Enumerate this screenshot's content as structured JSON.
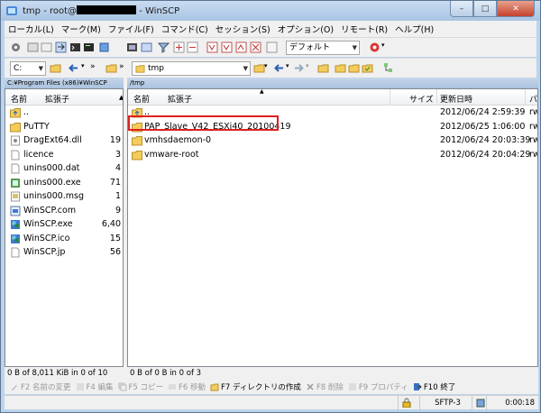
{
  "title": {
    "prefix": "tmp - root@",
    "suffix": " - WinSCP"
  },
  "window_buttons": {
    "minimize": "–",
    "maximize": "□",
    "close": "✕"
  },
  "menu": [
    "ローカル(L)",
    "マーク(M)",
    "ファイル(F)",
    "コマンド(C)",
    "セッション(S)",
    "オプション(O)",
    "リモート(R)",
    "ヘルプ(H)"
  ],
  "toolbar": {
    "transfer_setting": "デフォルト"
  },
  "local": {
    "drive": "C:",
    "path": "C:¥Program Files (x86)¥WinSCP",
    "columns": {
      "name": "名前",
      "ext": "拡張子"
    },
    "files": [
      {
        "name": "..",
        "size": "",
        "icon": "parent-folder-icon"
      },
      {
        "name": "PuTTY",
        "size": "",
        "icon": "folder-icon"
      },
      {
        "name": "DragExt64.dll",
        "size": "19",
        "icon": "dll-file-icon"
      },
      {
        "name": "licence",
        "size": "3",
        "icon": "text-file-icon"
      },
      {
        "name": "unins000.dat",
        "size": "4",
        "icon": "text-file-icon"
      },
      {
        "name": "unins000.exe",
        "size": "71",
        "icon": "exe-file-icon"
      },
      {
        "name": "unins000.msg",
        "size": "1",
        "icon": "msg-file-icon"
      },
      {
        "name": "WinSCP.com",
        "size": "9",
        "icon": "com-file-icon"
      },
      {
        "name": "WinSCP.exe",
        "size": "6,40",
        "icon": "winscp-exe-icon"
      },
      {
        "name": "WinSCP.ico",
        "size": "15",
        "icon": "winscp-ico-icon"
      },
      {
        "name": "WinSCP.jp",
        "size": "56",
        "icon": "text-file-icon"
      }
    ],
    "status": "0 B of 8,011 KiB in 0 of 10"
  },
  "remote": {
    "folder": "tmp",
    "path": "/tmp",
    "columns": {
      "name": "名前",
      "ext": "拡張子",
      "size": "サイズ",
      "modified": "更新日時",
      "rights": "パ"
    },
    "files": [
      {
        "name": "..",
        "modified": "2012/06/24 2:59:39",
        "rights": "rw",
        "icon": "parent-folder-icon"
      },
      {
        "name": "PAP_Slave_V42_ESXi40_20100419",
        "modified": "2012/06/25 1:06:00",
        "rights": "rw",
        "icon": "folder-icon"
      },
      {
        "name": "vmhsdaemon-0",
        "modified": "2012/06/24 20:03:39",
        "rights": "rw",
        "icon": "folder-icon"
      },
      {
        "name": "vmware-root",
        "modified": "2012/06/24 20:04:29",
        "rights": "rw",
        "icon": "folder-icon"
      }
    ],
    "status": "0 B of 0 B in 0 of 3"
  },
  "fkeys": [
    {
      "label": "F2 名前の変更",
      "enabled": false
    },
    {
      "label": "F4 編集",
      "enabled": false
    },
    {
      "label": "F5 コピー",
      "enabled": false
    },
    {
      "label": "F6 移動",
      "enabled": false
    },
    {
      "label": "F7 ディレクトリの作成",
      "enabled": true
    },
    {
      "label": "F8 削除",
      "enabled": false
    },
    {
      "label": "F9 プロパティ",
      "enabled": false
    },
    {
      "label": "F10 終了",
      "enabled": true
    }
  ],
  "bottom_status": {
    "protocol": "SFTP-3",
    "elapsed": "0:00:18"
  }
}
